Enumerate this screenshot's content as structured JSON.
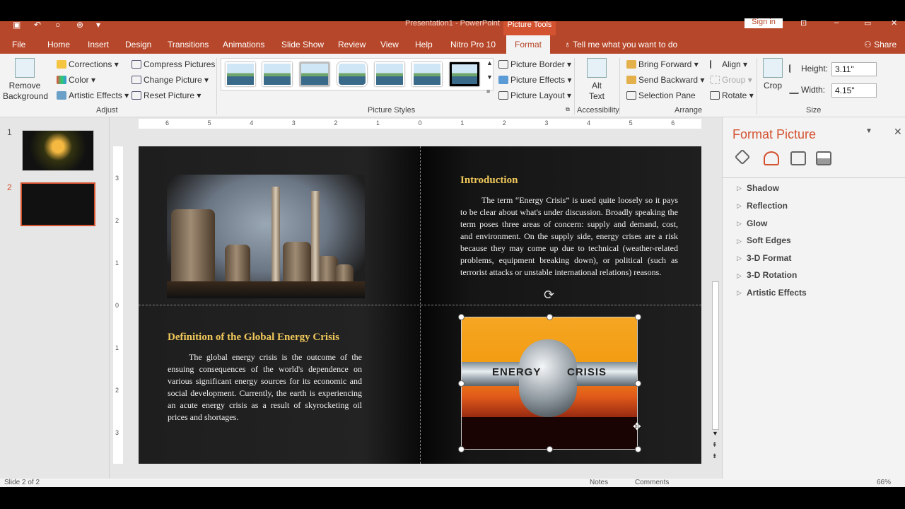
{
  "window": {
    "title": "Presentation1 - PowerPoint",
    "context_tab": "Picture Tools",
    "signin": "Sign in"
  },
  "tabs": [
    "File",
    "Home",
    "Insert",
    "Design",
    "Transitions",
    "Animations",
    "Slide Show",
    "Review",
    "View",
    "Help",
    "Nitro Pro 10",
    "Format"
  ],
  "active_tab": "Format",
  "tellme": "Tell me what you want to do",
  "share": "Share",
  "ribbon": {
    "remove_background": "Remove\nBackground",
    "corrections": "Corrections",
    "color": "Color",
    "artistic_effects": "Artistic Effects",
    "compress": "Compress Pictures",
    "change_picture": "Change Picture",
    "reset_picture": "Reset Picture",
    "adjust_group": "Adjust",
    "picture_styles_group": "Picture Styles",
    "picture_border": "Picture Border",
    "picture_effects": "Picture Effects",
    "picture_layout": "Picture Layout",
    "alt_text": "Alt\nText",
    "accessibility_group": "Accessibility",
    "bring_forward": "Bring Forward",
    "send_backward": "Send Backward",
    "selection_pane": "Selection Pane",
    "align": "Align",
    "group": "Group",
    "rotate": "Rotate",
    "arrange_group": "Arrange",
    "crop": "Crop",
    "height_label": "Height:",
    "height_value": "3.11\"",
    "width_label": "Width:",
    "width_value": "4.15\"",
    "size_group": "Size"
  },
  "slides_panel": {
    "items": [
      {
        "num": "1"
      },
      {
        "num": "2"
      }
    ]
  },
  "ruler_h": [
    "6",
    "5",
    "4",
    "3",
    "2",
    "1",
    "0",
    "1",
    "2",
    "3",
    "4",
    "5",
    "6"
  ],
  "ruler_v": [
    "3",
    "2",
    "1",
    "0",
    "1",
    "2",
    "3"
  ],
  "slide": {
    "left_heading": "Definition of the Global Energy Crisis",
    "left_text": "The global energy crisis is the outcome of the ensuing consequences of the world's dependence on various significant energy sources for its economic and social development. Currently, the earth is experiencing an acute energy crisis as a result of skyrocketing oil prices and shortages.",
    "right_heading": "Introduction",
    "right_text": "The term “Energy Crisis” is used quite loosely so it pays to be clear about what's under discussion. Broadly speaking the term poses three areas of concern: supply and demand, cost, and environment. On the supply side, energy crises are a risk because they may come up due to technical (weather-related problems, equipment breaking down), or political (such as terrorist attacks or unstable international relations) reasons.",
    "energy_word": "ENERGY",
    "crisis_word": "CRISIS"
  },
  "format_pane": {
    "title": "Format Picture",
    "sections": [
      "Shadow",
      "Reflection",
      "Glow",
      "Soft Edges",
      "3-D Format",
      "3-D Rotation",
      "Artistic Effects"
    ]
  },
  "status": {
    "slide": "Slide 2 of 2",
    "notes": "Notes",
    "comments": "Comments",
    "zoom": "66%"
  }
}
